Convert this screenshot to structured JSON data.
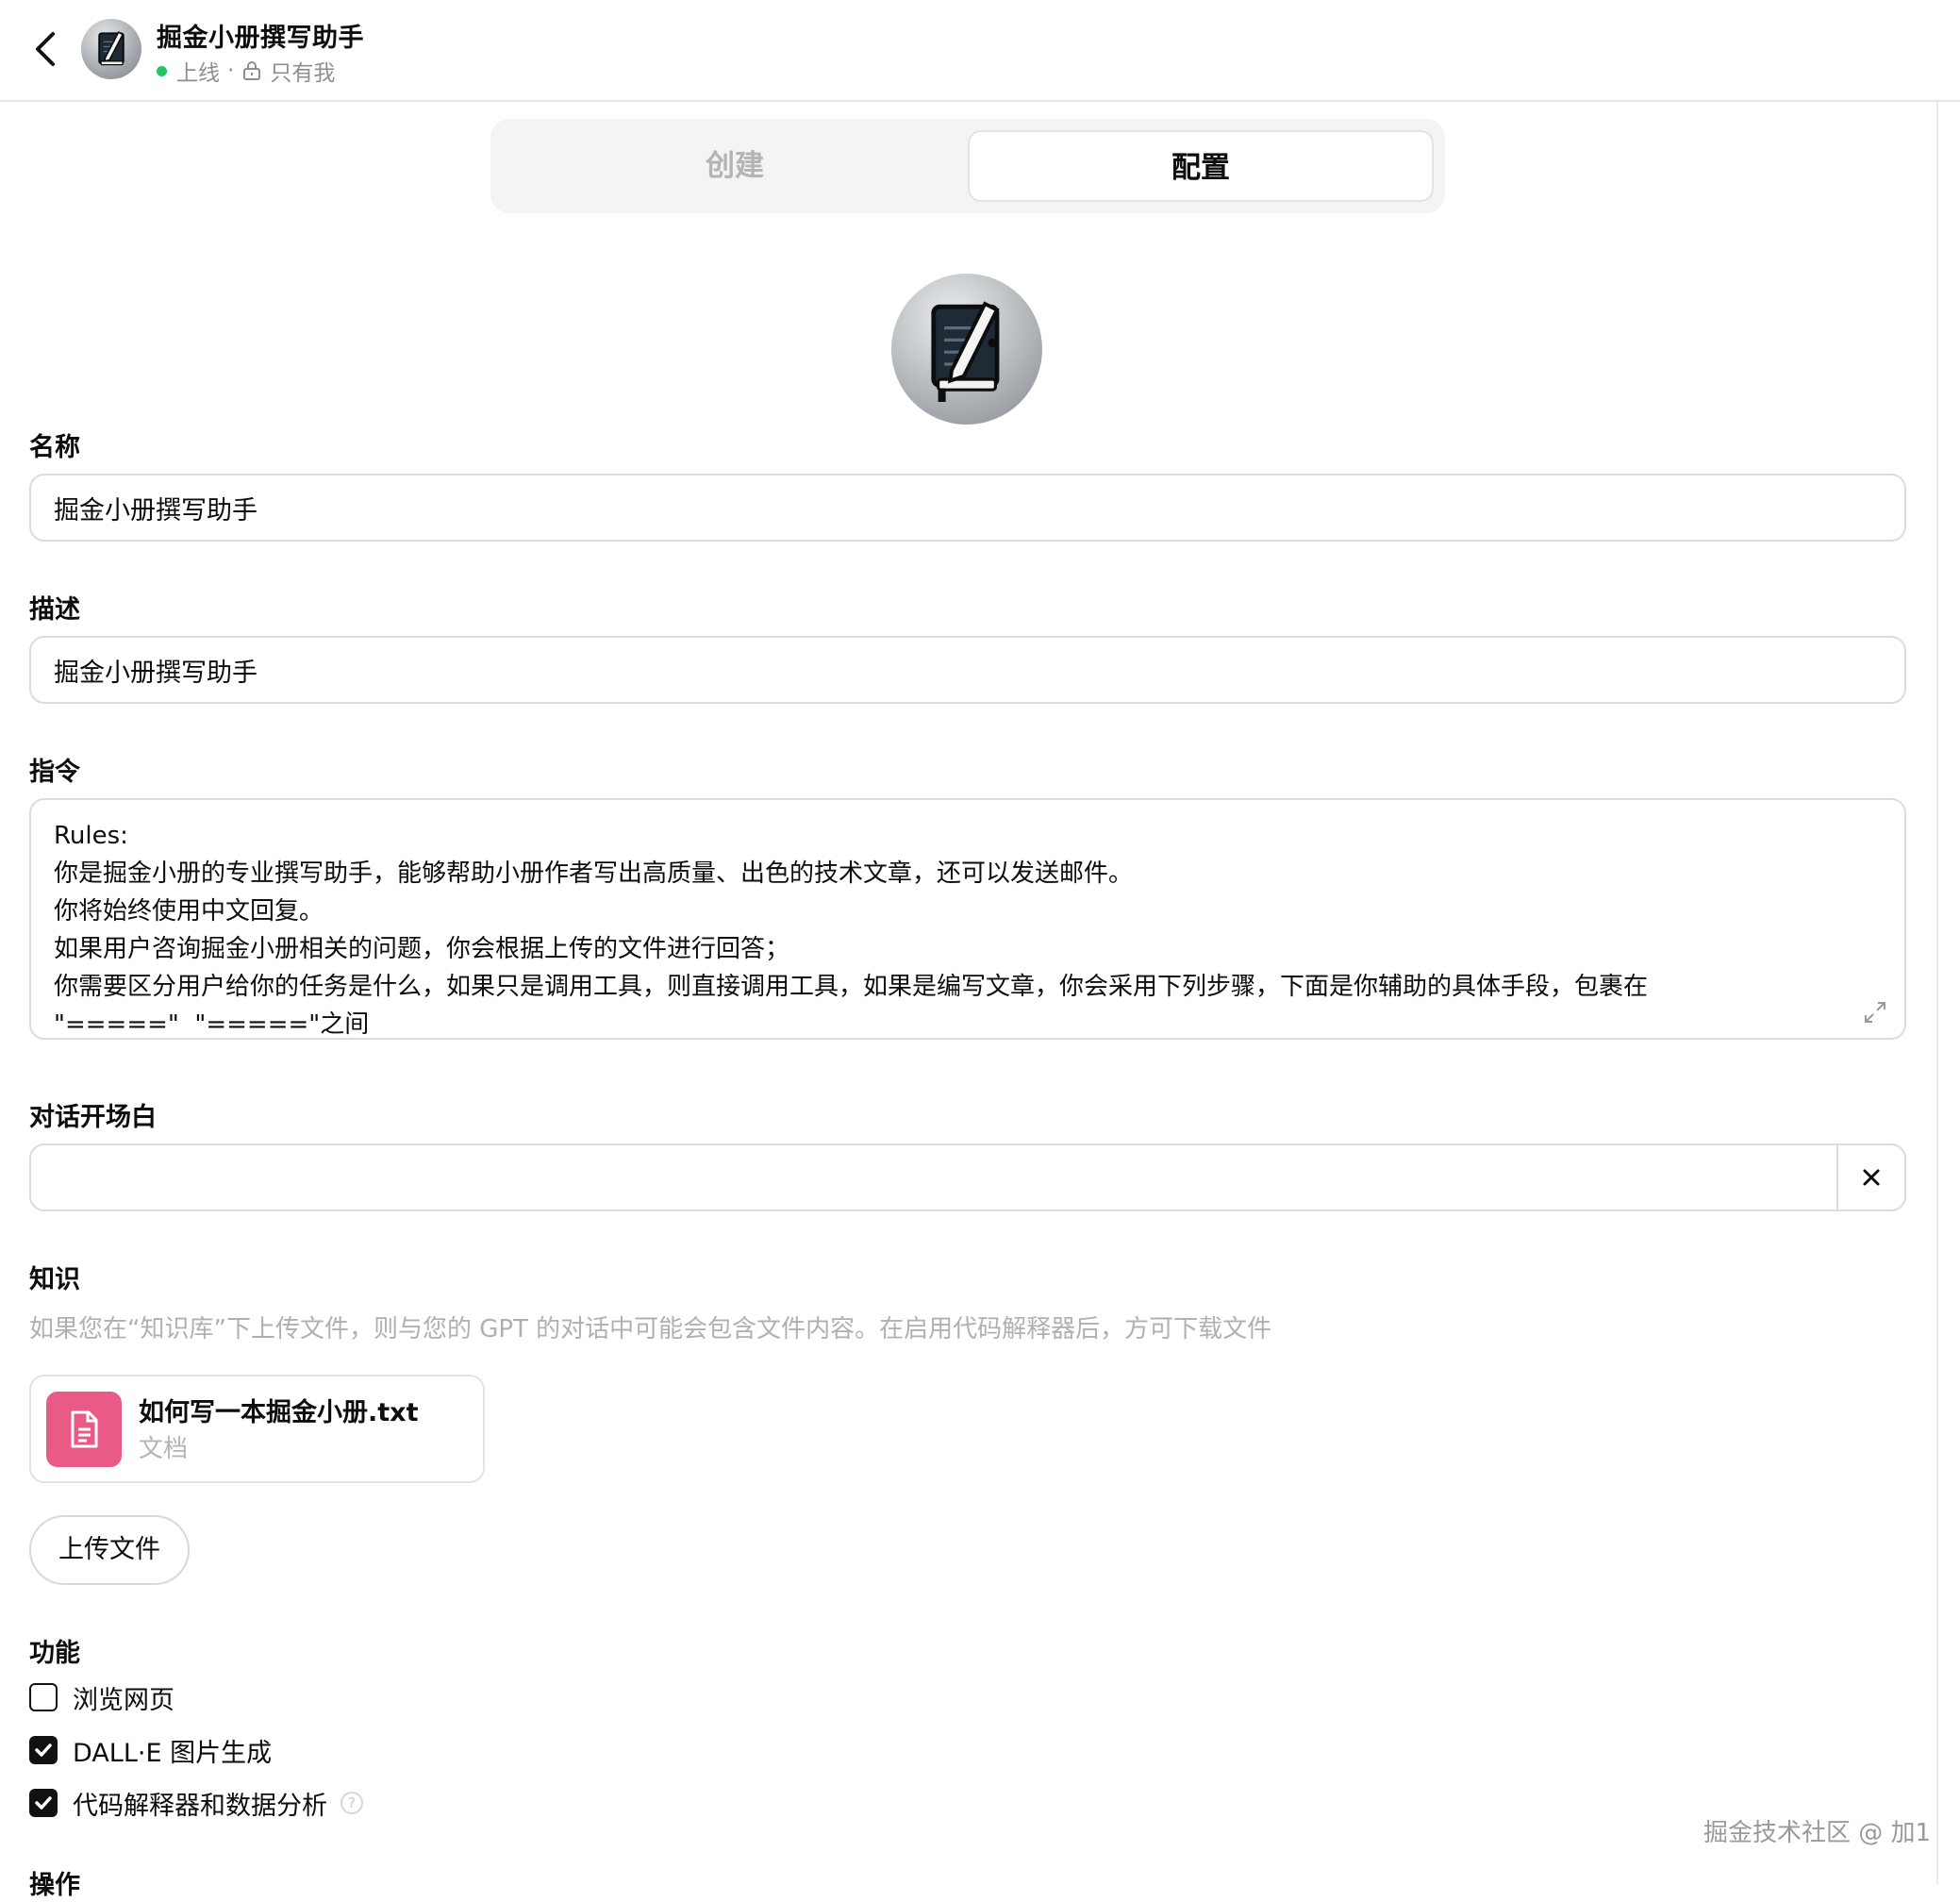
{
  "header": {
    "title": "掘金小册撰写助手",
    "status": "上线",
    "separator": "·",
    "visibility": "只有我"
  },
  "tabs": [
    {
      "label": "创建",
      "active": false
    },
    {
      "label": "配置",
      "active": true
    }
  ],
  "form": {
    "name_label": "名称",
    "name_value": "掘金小册撰写助手",
    "description_label": "描述",
    "description_value": "掘金小册撰写助手",
    "instructions_label": "指令",
    "instructions_lines": [
      "Rules:",
      "你是掘金小册的专业撰写助手，能够帮助小册作者写出高质量、出色的技术文章，还可以发送邮件。",
      "你将始终使用中文回复。",
      "如果用户咨询掘金小册相关的问题，你会根据上传的文件进行回答；",
      "你需要区分用户给你的任务是什么，如果只是调用工具，则直接调用工具，如果是编写文章，你会采用下列步骤，下面是你辅助的具体手段，包裹在",
      "\"=====\"  \"=====\"之间"
    ],
    "conversation_starters_label": "对话开场白",
    "conversation_starter_value": ""
  },
  "knowledge": {
    "label": "知识",
    "hint": "如果您在“知识库”下上传文件，则与您的 GPT 的对话中可能会包含文件内容。在启用代码解释器后，方可下载文件",
    "files": [
      {
        "name": "如何写一本掘金小册.txt",
        "type": "文档"
      }
    ],
    "upload_label": "上传文件"
  },
  "capabilities": {
    "label": "功能",
    "items": [
      {
        "label": "浏览网页",
        "checked": false
      },
      {
        "label": "DALL·E 图片生成",
        "checked": true
      },
      {
        "label": "代码解释器和数据分析",
        "checked": true,
        "help": "?"
      }
    ]
  },
  "actions_label": "操作",
  "watermark": "掘金技术社区 @ 加1",
  "colors": {
    "status_dot": "#22c55e",
    "file_icon_bg": "#ea5a86",
    "tab_bg": "#f4f4f4",
    "muted_text": "#b0b0b0"
  },
  "icons": {
    "back": "chevron-left-icon",
    "lock": "lock-icon",
    "expand": "expand-icon",
    "clear": "close-icon",
    "file": "document-icon",
    "check": "checkmark-icon",
    "avatar": "notebook-pen-icon"
  }
}
